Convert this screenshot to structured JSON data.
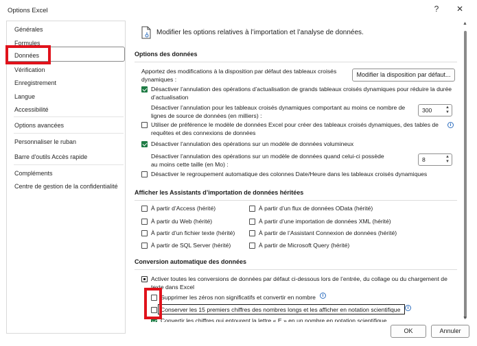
{
  "window": {
    "title": "Options Excel",
    "help_label": "?",
    "close_label": "✕"
  },
  "sidebar": {
    "items": [
      {
        "label": "Générales"
      },
      {
        "label": "Formules"
      },
      {
        "label": "Données"
      },
      {
        "label": "Vérification"
      },
      {
        "label": "Enregistrement"
      },
      {
        "label": "Langue"
      },
      {
        "label": "Accessibilité"
      },
      {
        "label": "Options avancées"
      },
      {
        "label": "Personnaliser le ruban"
      },
      {
        "label": "Barre d'outils Accès rapide"
      },
      {
        "label": "Compléments"
      },
      {
        "label": "Centre de gestion de la confidentialité"
      }
    ],
    "selected": "Données"
  },
  "header": {
    "text": "Modifier les options relatives à l’importation et l’analyse de données."
  },
  "data_options": {
    "title": "Options des données",
    "default_layout_text": "Apportez des modifications à la disposition par défaut des tableaux croisés dynamiques :",
    "default_layout_button": "Modifier la disposition par défaut...",
    "disable_undo_large_pt": "Désactiver l’annulation des opérations d’actualisation de grands tableaux croisés dynamiques pour réduire la durée d’actualisation",
    "disable_undo_large_pt_checked": true,
    "disable_undo_rows_text": "Désactiver l’annulation pour les tableaux croisés dynamiques comportant au moins ce nombre de lignes de source de données (en milliers) :",
    "disable_undo_rows_value": "300",
    "prefer_data_model": "Utiliser de préférence le modèle de données Excel pour créer des tableaux croisés dynamiques, des tables de requêtes et des connexions de données",
    "prefer_data_model_checked": false,
    "disable_undo_model": "Désactiver l’annulation des opérations sur un modèle de données volumineux",
    "disable_undo_model_checked": true,
    "disable_undo_model_size_text": "Désactiver l’annulation des opérations sur un modèle de données quand celui-ci possède au moins cette taille (en Mo) :",
    "disable_undo_model_size_value": "8",
    "disable_auto_grouping": "Désactiver le regroupement automatique des colonnes Date/Heure dans les tableaux croisés dynamiques",
    "disable_auto_grouping_checked": false
  },
  "legacy_wizards": {
    "title": "Afficher les Assistants d’importation de données héritées",
    "left": [
      {
        "label": "À partir d’Access (hérité)"
      },
      {
        "label": "À partir du Web (hérité)"
      },
      {
        "label": "À partir d’un fichier texte (hérité)"
      },
      {
        "label": "À partir de SQL Server (hérité)"
      }
    ],
    "right": [
      {
        "label": "À partir d’un flux de données OData (hérité)"
      },
      {
        "label": "À partir d’une importation de données XML (hérité)"
      },
      {
        "label": "À partir de l’Assistant Connexion de données (hérité)"
      },
      {
        "label": "À partir de Microsoft Query (hérité)"
      }
    ]
  },
  "auto_conversion": {
    "title": "Conversion automatique des données",
    "enable_all": "Activer toutes les conversions de données par défaut ci-dessous lors de l’entrée, du collage ou du chargement de texte dans Excel",
    "remove_zeros": "Supprimer les zéros non significatifs et convertir en nombre",
    "keep_15_digits": "Conserver les 15 premiers chiffres des nombres longs et les afficher en notation scientifique",
    "convert_e": "Convertir les chiffres qui entourent la lettre « E » en un nombre en notation scientifique"
  },
  "footer": {
    "ok": "OK",
    "cancel": "Annuler"
  },
  "colors": {
    "accent": "#1e7b44",
    "highlight": "#e0121b",
    "info": "#2f6fbf"
  }
}
